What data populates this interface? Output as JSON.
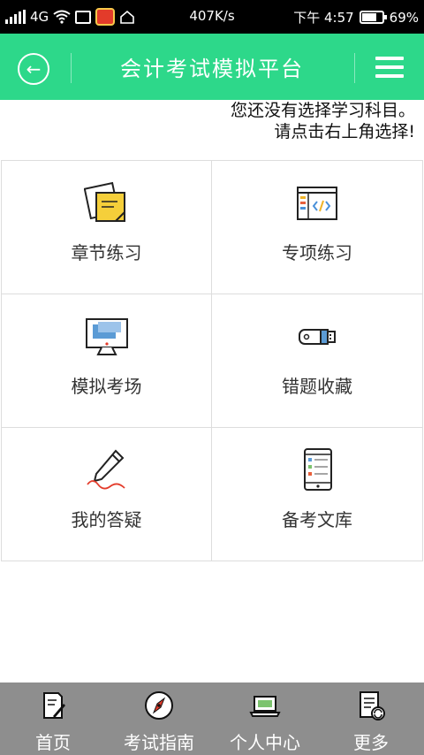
{
  "status_bar": {
    "network": "4G",
    "speed": "407K/s",
    "time": "下午 4:57",
    "battery": "69%"
  },
  "app_bar": {
    "title": "会计考试模拟平台"
  },
  "notice": {
    "line1": "您还没有选择学习科目。",
    "line2": "请点击右上角选择!"
  },
  "grid": {
    "items": [
      {
        "label": "章节练习",
        "icon": "sticky-note-icon"
      },
      {
        "label": "专项练习",
        "icon": "code-window-icon"
      },
      {
        "label": "模拟考场",
        "icon": "monitor-icon"
      },
      {
        "label": "错题收藏",
        "icon": "usb-drive-icon"
      },
      {
        "label": "我的答疑",
        "icon": "pen-icon"
      },
      {
        "label": "备考文库",
        "icon": "tablet-icon"
      }
    ]
  },
  "bottom_nav": {
    "items": [
      {
        "label": "首页",
        "icon": "document-pen-icon"
      },
      {
        "label": "考试指南",
        "icon": "compass-icon"
      },
      {
        "label": "个人中心",
        "icon": "laptop-icon"
      },
      {
        "label": "更多",
        "icon": "list-refresh-icon"
      }
    ]
  },
  "colors": {
    "accent": "#2dd88a",
    "bottom_bar": "#8e8e8e",
    "status_bar": "#000000"
  }
}
